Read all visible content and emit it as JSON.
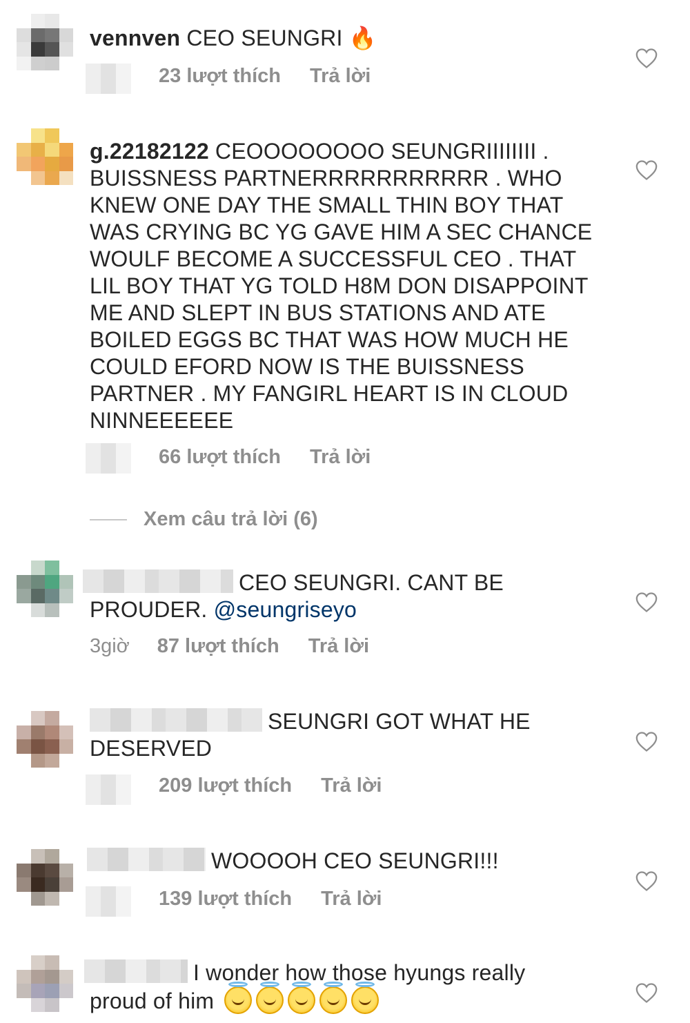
{
  "comments": [
    {
      "username": "vennven",
      "text": "CEO SEUNGRI",
      "emoji": "🔥",
      "likes": "23 lượt thích",
      "reply": "Trả lời",
      "avatar_colors": [
        "#ffffff",
        "#eeeeee",
        "#e8e8e8",
        "#ffffff",
        "#dddddd",
        "#6b6b6b",
        "#777777",
        "#d8d8d8",
        "#e5e5e5",
        "#3a3a3a",
        "#555555",
        "#e0e0e0",
        "#f2f2f2",
        "#cfcfcf",
        "#cccccc",
        "#ffffff"
      ]
    },
    {
      "username": "g.22182122",
      "text": "CEOOOOOOOO SEUNGRIIIIIIII . BUISSNESS PARTNERRRRRRRRRRR . WHO KNEW ONE DAY THE SMALL THIN BOY THAT WAS CRYING BC YG GAVE HIM A SEC CHANCE WOULF BECOME A SUCCESSFUL CEO . THAT LIL BOY THAT YG TOLD H8M DON DISAPPOINT ME AND SLEPT IN BUS STATIONS AND ATE BOILED EGGS BC THAT WAS HOW MUCH HE COULD EFORD NOW IS THE BUISSNESS PARTNER . MY FANGIRL HEART IS IN CLOUD NINNEEEEEE",
      "likes": "66 lượt thích",
      "reply": "Trả lời",
      "avatar_colors": [
        "#ffffff",
        "#f7e28a",
        "#f0c85a",
        "#ffffff",
        "#f2c774",
        "#e8b048",
        "#f5d97a",
        "#eea64a",
        "#f0b878",
        "#f2a45c",
        "#e6aa40",
        "#e89a48",
        "#ffffff",
        "#f2c590",
        "#eaa84e",
        "#f4e0c0"
      ]
    },
    {
      "text_line1": "CEO SEUNGRI. CANT BE",
      "text_line2": "PROUDER.",
      "mention": "@seungriseyo",
      "time": "3giờ",
      "likes": "87 lượt thích",
      "reply": "Trả lời",
      "avatar_colors": [
        "#ffffff",
        "#c8d8cc",
        "#7fbf9e",
        "#ffffff",
        "#8a9a90",
        "#6e8a7c",
        "#4fa680",
        "#b0c4b8",
        "#9aa8a0",
        "#5a6a64",
        "#6f8a88",
        "#c0ccc6",
        "#ffffff",
        "#d8dcda",
        "#b8c0bc",
        "#ffffff"
      ]
    },
    {
      "text_line1": "SEUNGRI GOT WHAT HE",
      "text_line2": "DESERVED",
      "likes": "209 lượt thích",
      "reply": "Trả lời",
      "avatar_colors": [
        "#ffffff",
        "#d8c8c2",
        "#c4aaa0",
        "#ffffff",
        "#c8b0a8",
        "#9a7a6a",
        "#b08878",
        "#d4c0b8",
        "#a08070",
        "#7a5444",
        "#8a6050",
        "#c8b0a4",
        "#ffffff",
        "#b49888",
        "#c2a89a",
        "#ffffff"
      ]
    },
    {
      "text_line1": "WOOOOH CEO SEUNGRI!!!",
      "likes": "139 lượt thích",
      "reply": "Trả lời",
      "avatar_colors": [
        "#ffffff",
        "#c8c0b8",
        "#b0a89c",
        "#ffffff",
        "#8a7a70",
        "#4a3a30",
        "#5a4a40",
        "#b8b0a8",
        "#9a8a80",
        "#3a2a20",
        "#4a4038",
        "#a89c94",
        "#ffffff",
        "#a09890",
        "#c0b8b0",
        "#ffffff"
      ]
    },
    {
      "text_line1": "I wonder how those hyungs really",
      "text_line2": "proud of him",
      "emoji_count": 5,
      "avatar_colors": [
        "#ffffff",
        "#d8cfc8",
        "#c8bcb4",
        "#ffffff",
        "#cfc4bc",
        "#b0a098",
        "#a49890",
        "#d4ccc6",
        "#c4bcb8",
        "#a8a4b8",
        "#9ca0b4",
        "#ccc8cc",
        "#ffffff",
        "#d8d4d8",
        "#c8c4c8",
        "#ffffff"
      ]
    }
  ],
  "view_replies": "Xem câu trả lời (6)",
  "heart_icon": "heart-outline-icon",
  "colors": {
    "text": "#262626",
    "meta": "#8e8e8e",
    "mention": "#003569"
  }
}
